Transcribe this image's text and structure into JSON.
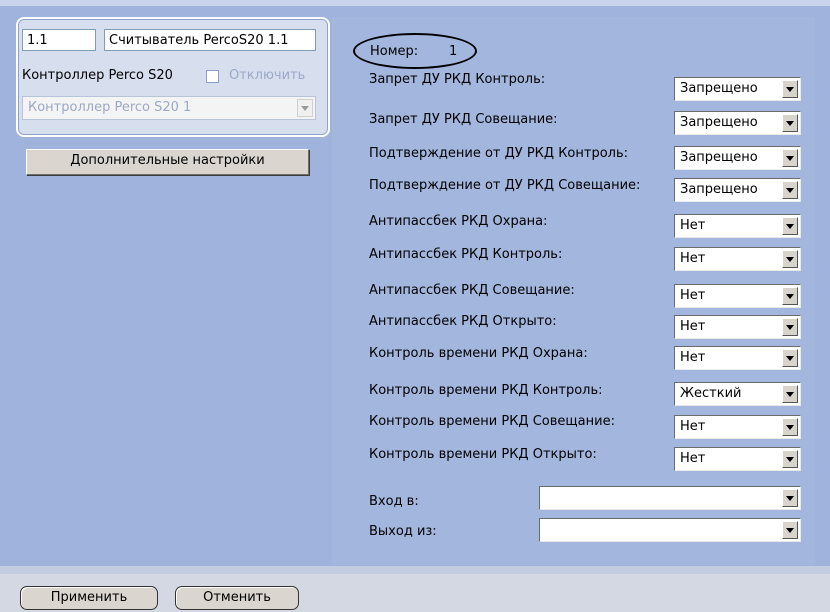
{
  "reader": {
    "number": "1.1",
    "name": "Считыватель PercoS20 1.1",
    "controller_label": "Контроллер Perco S20",
    "disable_label": "Отключить",
    "controller_value": "Контроллер Perco S20 1"
  },
  "advanced_button": "Дополнительные настройки",
  "number_label": "Номер:",
  "number_value": "1",
  "settings": [
    {
      "label": "Запрет ДУ РКД Контроль:",
      "value": "Запрещено"
    },
    {
      "label": "Запрет ДУ РКД Совещание:",
      "value": "Запрещено"
    },
    {
      "label": "Подтверждение от ДУ РКД Контроль:",
      "value": "Запрещено"
    },
    {
      "label": "Подтверждение от ДУ РКД Совещание:",
      "value": "Запрещено"
    },
    {
      "label": "Антипассбек РКД Охрана:",
      "value": "Нет"
    },
    {
      "label": "Антипассбек РКД Контроль:",
      "value": "Нет"
    },
    {
      "label": "Антипассбек РКД Совещание:",
      "value": "Нет"
    },
    {
      "label": "Антипассбек РКД Открыто:",
      "value": "Нет"
    },
    {
      "label": "Контроль времени РКД Охрана:",
      "value": "Нет"
    },
    {
      "label": "Контроль времени РКД Контроль:",
      "value": "Жесткий"
    },
    {
      "label": "Контроль времени РКД Совещание:",
      "value": "Нет"
    },
    {
      "label": "Контроль времени РКД Открыто:",
      "value": "Нет"
    }
  ],
  "entry_label": "Вход в:",
  "entry_value": "",
  "exit_label": "Выход из:",
  "exit_value": "",
  "apply_button": "Применить",
  "cancel_button": "Отменить"
}
